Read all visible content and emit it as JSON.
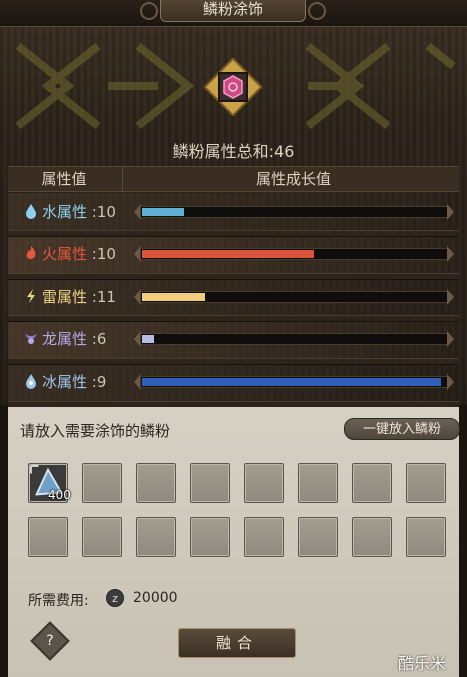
{
  "header": {
    "title": "鳞粉涂饰"
  },
  "summary": {
    "label": "鳞粉属性总和",
    "value": ":46"
  },
  "table": {
    "col_attr": "属性值",
    "col_growth": "属性成长值",
    "rows": [
      {
        "name": "水属性",
        "value": ":10",
        "icon": "water-drop-icon",
        "color": "#8fd0ee",
        "bar_color": "#5fb2d6",
        "fraction": 0.14
      },
      {
        "name": "火属性",
        "value": ":10",
        "icon": "fire-icon",
        "color": "#e8583c",
        "bar_color": "#d8543a",
        "fraction": 0.57
      },
      {
        "name": "雷属性",
        "value": ":11",
        "icon": "thunder-icon",
        "color": "#eed48a",
        "bar_color": "#f1cd7c",
        "fraction": 0.21
      },
      {
        "name": "龙属性",
        "value": ":6",
        "icon": "dragon-icon",
        "color": "#b9a6e6",
        "bar_color": "#b7bde2",
        "fraction": 0.04
      },
      {
        "name": "冰属性",
        "value": ":9",
        "icon": "ice-icon",
        "color": "#9cc6ee",
        "bar_color": "#2f5fb8",
        "fraction": 0.99
      }
    ]
  },
  "bottom": {
    "prompt": "请放入需要涂饰的鳞粉",
    "one_click_label": "一键放入鳞粉",
    "slot_item_qty": "400",
    "cost_label": "所需费用:",
    "zenny_symbol": "z",
    "cost_value": "20000",
    "help_symbol": "?",
    "fuse_label": "融合"
  },
  "watermark": "酷乐米"
}
